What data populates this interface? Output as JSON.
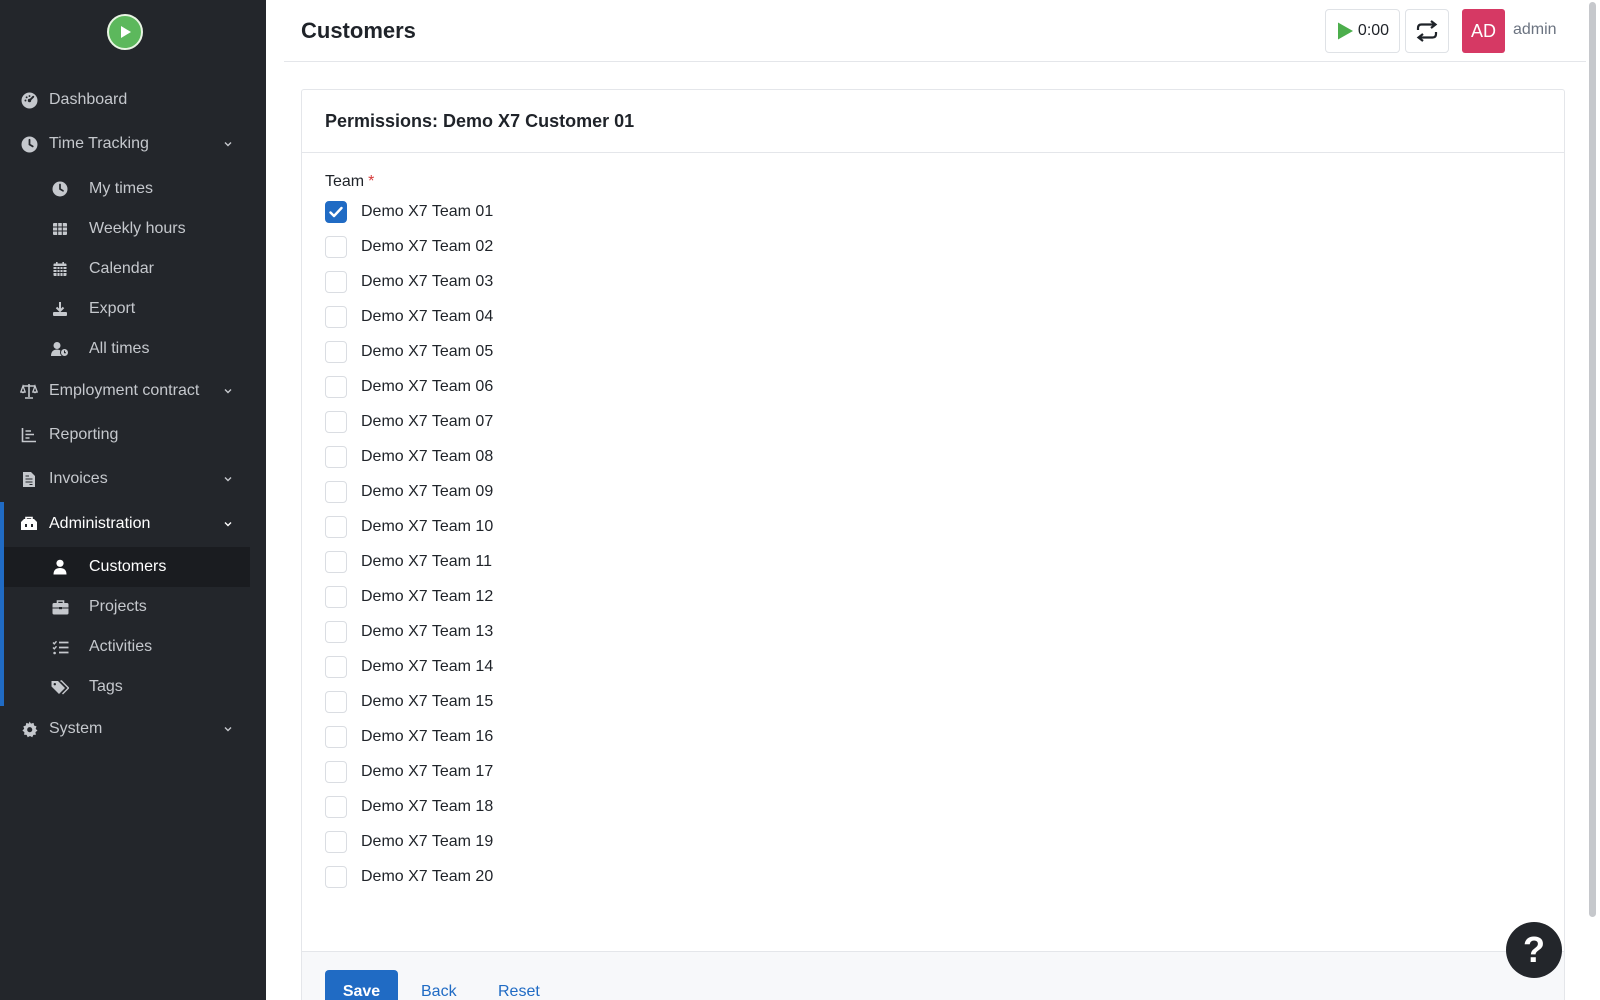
{
  "sidebar": {
    "logo": "play-logo",
    "items": [
      {
        "label": "Dashboard",
        "icon": "dashboard-icon"
      },
      {
        "label": "Time Tracking",
        "icon": "clock-icon"
      },
      {
        "label": "Employment contract",
        "icon": "scale-icon"
      },
      {
        "label": "Reporting",
        "icon": "chart-icon"
      },
      {
        "label": "Invoices",
        "icon": "invoice-icon"
      },
      {
        "label": "Administration",
        "icon": "toolbox-icon"
      },
      {
        "label": "System",
        "icon": "gear-icon"
      }
    ],
    "time_tracking_sub": [
      {
        "label": "My times",
        "icon": "clock-icon"
      },
      {
        "label": "Weekly hours",
        "icon": "grid-icon"
      },
      {
        "label": "Calendar",
        "icon": "calendar-icon"
      },
      {
        "label": "Export",
        "icon": "download-icon"
      },
      {
        "label": "All times",
        "icon": "user-clock-icon"
      }
    ],
    "administration_sub": [
      {
        "label": "Customers",
        "icon": "user-icon"
      },
      {
        "label": "Projects",
        "icon": "briefcase-icon"
      },
      {
        "label": "Activities",
        "icon": "list-icon"
      },
      {
        "label": "Tags",
        "icon": "tags-icon"
      }
    ]
  },
  "header": {
    "title": "Customers",
    "timer": "0:00",
    "avatar_initials": "AD",
    "username": "admin"
  },
  "card": {
    "title": "Permissions: Demo X7 Customer 01",
    "field_label": "Team",
    "required_mark": "*",
    "teams": [
      {
        "label": "Demo X7 Team 01",
        "checked": true
      },
      {
        "label": "Demo X7 Team 02",
        "checked": false
      },
      {
        "label": "Demo X7 Team 03",
        "checked": false
      },
      {
        "label": "Demo X7 Team 04",
        "checked": false
      },
      {
        "label": "Demo X7 Team 05",
        "checked": false
      },
      {
        "label": "Demo X7 Team 06",
        "checked": false
      },
      {
        "label": "Demo X7 Team 07",
        "checked": false
      },
      {
        "label": "Demo X7 Team 08",
        "checked": false
      },
      {
        "label": "Demo X7 Team 09",
        "checked": false
      },
      {
        "label": "Demo X7 Team 10",
        "checked": false
      },
      {
        "label": "Demo X7 Team 11",
        "checked": false
      },
      {
        "label": "Demo X7 Team 12",
        "checked": false
      },
      {
        "label": "Demo X7 Team 13",
        "checked": false
      },
      {
        "label": "Demo X7 Team 14",
        "checked": false
      },
      {
        "label": "Demo X7 Team 15",
        "checked": false
      },
      {
        "label": "Demo X7 Team 16",
        "checked": false
      },
      {
        "label": "Demo X7 Team 17",
        "checked": false
      },
      {
        "label": "Demo X7 Team 18",
        "checked": false
      },
      {
        "label": "Demo X7 Team 19",
        "checked": false
      },
      {
        "label": "Demo X7 Team 20",
        "checked": false
      }
    ],
    "save_label": "Save",
    "back_label": "Back",
    "reset_label": "Reset"
  },
  "help": {
    "label": "?"
  },
  "colors": {
    "sidebar_bg": "#23262b",
    "accent": "#206bc4",
    "avatar_bg": "#d63964",
    "logo_green": "#5cb85c",
    "play_green": "#4cae4c"
  }
}
